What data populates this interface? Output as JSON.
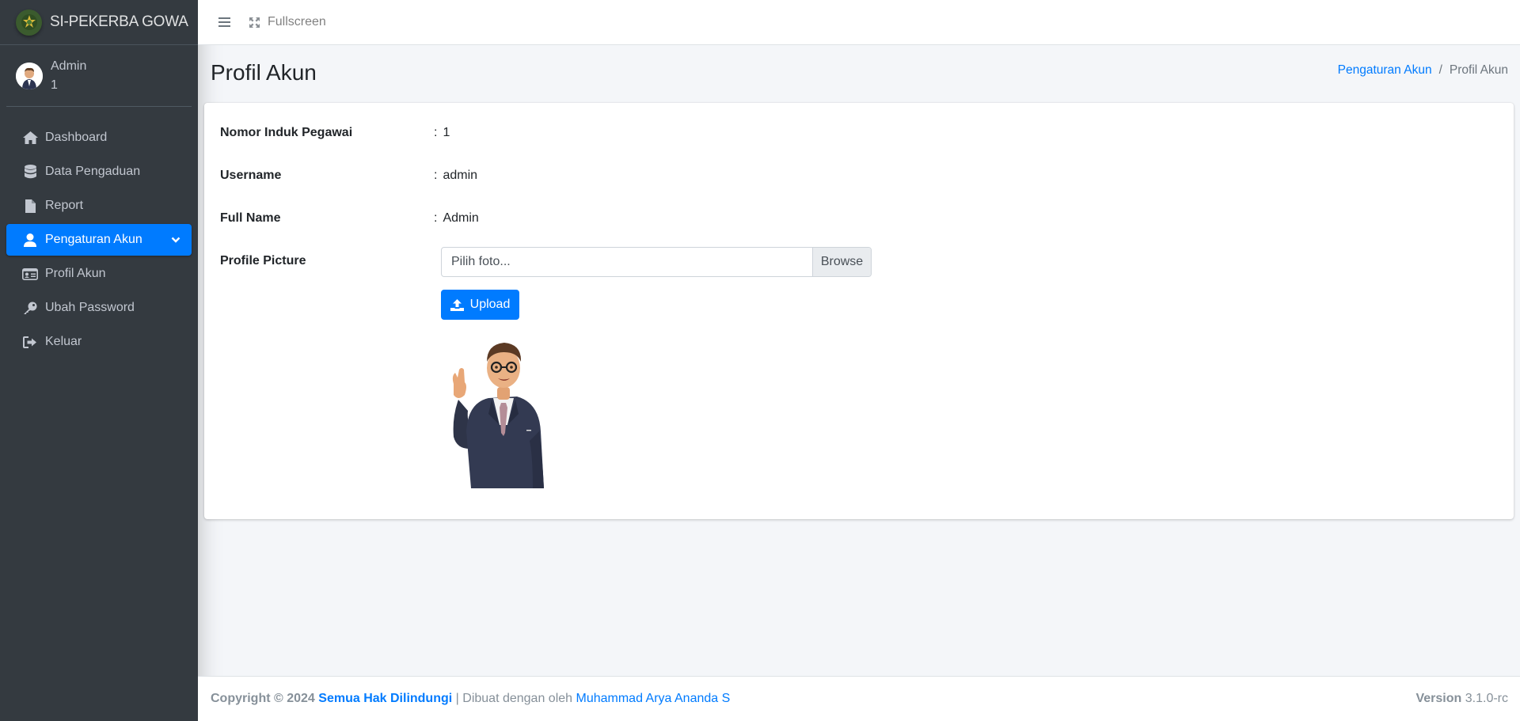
{
  "brand": {
    "title": "SI-PEKERBA GOWA"
  },
  "user": {
    "name": "Admin",
    "nip": "1"
  },
  "sidebar": {
    "items": [
      {
        "label": "Dashboard",
        "icon": "home-icon"
      },
      {
        "label": "Data Pengaduan",
        "icon": "database-icon"
      },
      {
        "label": "Report",
        "icon": "file-icon"
      },
      {
        "label": "Pengaturan Akun",
        "icon": "user-icon",
        "active": true
      },
      {
        "label": "Profil Akun",
        "icon": "id-card-icon"
      },
      {
        "label": "Ubah Password",
        "icon": "key-icon"
      },
      {
        "label": "Keluar",
        "icon": "sign-out-icon"
      }
    ]
  },
  "navbar": {
    "fullscreen_label": "Fullscreen"
  },
  "page": {
    "title": "Profil Akun"
  },
  "breadcrumb": {
    "parent": "Pengaturan Akun",
    "separator": "/",
    "current": "Profil Akun"
  },
  "profile": {
    "nip_label": "Nomor Induk Pegawai",
    "nip_value": "1",
    "username_label": "Username",
    "username_value": "admin",
    "fullname_label": "Full Name",
    "fullname_value": "Admin",
    "picture_label": "Profile Picture",
    "colon": ":",
    "file_placeholder": "Pilih foto...",
    "browse_label": "Browse",
    "upload_label": "Upload"
  },
  "footer": {
    "copyright": "Copyright © 2024",
    "rights": "Semua Hak Dilindungi",
    "made_by_prefix": "| Dibuat dengan oleh",
    "author": "Muhammad Arya Ananda S",
    "version_label": "Version",
    "version_value": "3.1.0-rc"
  },
  "colors": {
    "primary": "#007bff",
    "sidebar_bg": "#343a40",
    "content_bg": "#f4f6f9"
  }
}
